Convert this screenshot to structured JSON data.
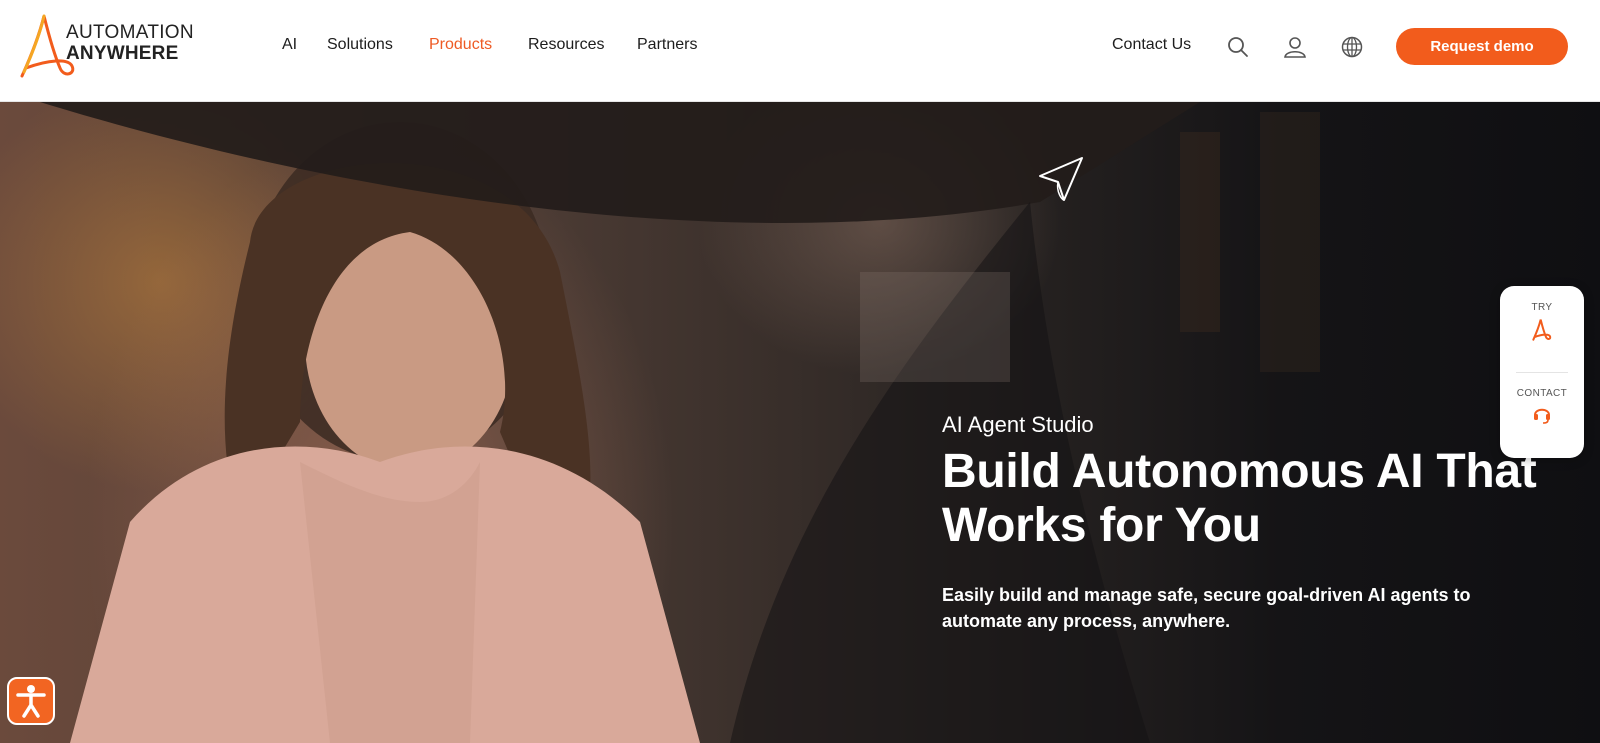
{
  "brand": {
    "line1": "AUTOMATION",
    "line2": "ANYWHERE",
    "accent": "#f25c1c"
  },
  "nav": {
    "items": [
      {
        "label": "AI",
        "active": false
      },
      {
        "label": "Solutions",
        "active": false
      },
      {
        "label": "Products",
        "active": true
      },
      {
        "label": "Resources",
        "active": false
      },
      {
        "label": "Partners",
        "active": false
      }
    ]
  },
  "header": {
    "contact_label": "Contact Us",
    "icons": [
      "search-icon",
      "user-icon",
      "globe-icon"
    ],
    "cta_label": "Request demo"
  },
  "hero": {
    "eyebrow": "AI Agent Studio",
    "title": "Build Autonomous AI That Works for You",
    "subtitle": "Easily build and manage safe, secure goal-driven AI agents to automate any process, anywhere."
  },
  "side_widget": {
    "try_label": "TRY",
    "contact_label": "CONTACT"
  },
  "colors": {
    "accent": "#f25c1c",
    "active_nav": "#ee5a24",
    "text": "#1d1d1d"
  }
}
